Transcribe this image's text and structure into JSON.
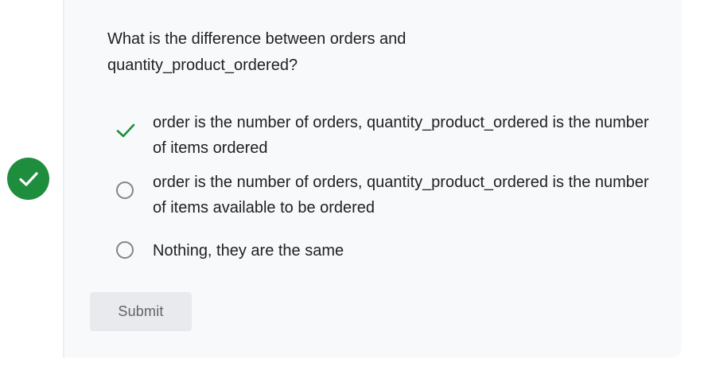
{
  "quiz": {
    "question": "What is the difference between orders and quantity_product_ordered?",
    "options": [
      {
        "label": "order is the number of orders, quantity_product_ordered is the number of items ordered",
        "state": "correct-selected"
      },
      {
        "label": "order is the number of orders, quantity_product_ordered is the number of items available to be ordered",
        "state": "unselected"
      },
      {
        "label": "Nothing, they are the same",
        "state": "unselected"
      }
    ],
    "submit_label": "Submit",
    "result_icon": "check-circle-icon"
  },
  "colors": {
    "success": "#1e8e3e",
    "card_background": "#f8f9fa",
    "text": "#202124",
    "radio_border": "#80868b",
    "button_background": "#e8eaed",
    "button_text": "#5f6368"
  }
}
